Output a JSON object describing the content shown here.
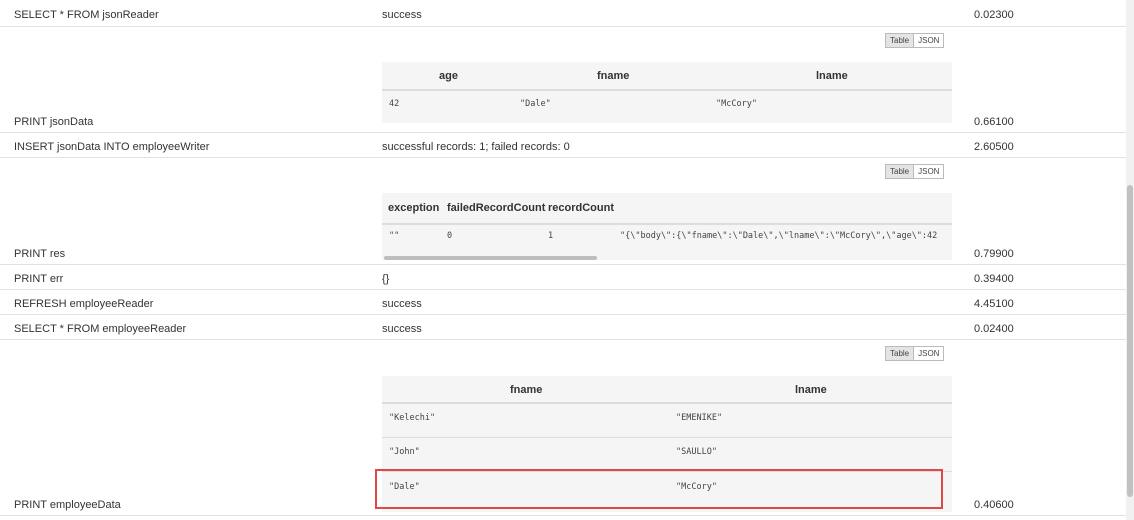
{
  "rows": [
    {
      "command": "SELECT * FROM jsonReader",
      "result": "success",
      "time": "0.02300"
    },
    {
      "command": "PRINT jsonData",
      "time": "0.66100"
    },
    {
      "command": "INSERT jsonData INTO employeeWriter",
      "result": "successful records: 1; failed records: 0",
      "time": "2.60500"
    },
    {
      "command": "PRINT res",
      "time": "0.79900"
    },
    {
      "command": "PRINT err",
      "result": "{}",
      "time": "0.39400"
    },
    {
      "command": "REFRESH employeeReader",
      "result": "success",
      "time": "4.45100"
    },
    {
      "command": "SELECT * FROM employeeReader",
      "result": "success",
      "time": "0.02400"
    },
    {
      "command": "PRINT employeeData",
      "time": "0.40600"
    }
  ],
  "toggle": {
    "table": "Table",
    "json": "JSON"
  },
  "json_table": {
    "headers": [
      "age",
      "fname",
      "lname"
    ],
    "rows": [
      [
        "42",
        "\"Dale\"",
        "\"McCory\""
      ]
    ]
  },
  "res_table": {
    "headers": [
      "exception",
      "failedRecordCount",
      "recordCount"
    ],
    "rows": [
      [
        "\"\"",
        "0",
        "1",
        "\"{\\\"body\\\":{\\\"fname\\\":\\\"Dale\\\",\\\"lname\\\":\\\"McCory\\\",\\\"age\\\":42"
      ]
    ]
  },
  "employee_table": {
    "headers": [
      "fname",
      "lname"
    ],
    "rows": [
      [
        "\"Kelechi\"",
        "\"EMENIKE\""
      ],
      [
        "\"John\"",
        "\"SAULLO\""
      ],
      [
        "\"Dale\"",
        "\"McCory\""
      ]
    ]
  },
  "colors": {
    "highlight": "#e04848",
    "table_bg": "#f5f5f5"
  }
}
